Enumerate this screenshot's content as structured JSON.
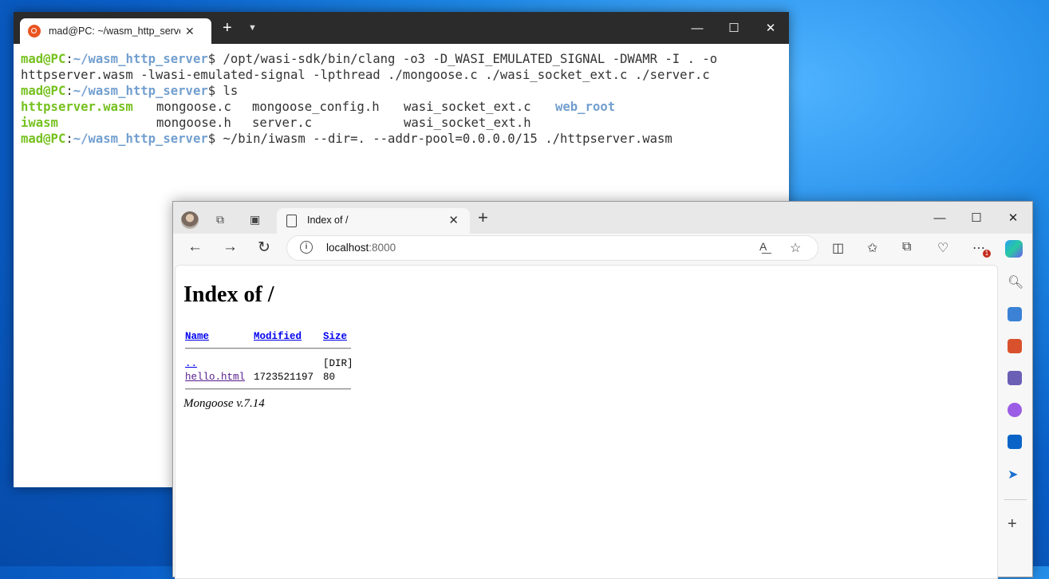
{
  "terminal": {
    "tab_title": "mad@PC: ~/wasm_http_server",
    "user_host": "mad@PC",
    "path": "~/wasm_http_server",
    "lines": [
      {
        "type": "prompt",
        "command": " /opt/wasi-sdk/bin/clang -o3 -D_WASI_EMULATED_SIGNAL -DWAMR -I . -o"
      },
      {
        "type": "plain",
        "text": "httpserver.wasm -lwasi-emulated-signal -lpthread ./mongoose.c ./wasi_socket_ext.c ./server.c"
      },
      {
        "type": "prompt",
        "command": " ls"
      },
      {
        "type": "plain",
        "text": ""
      },
      {
        "type": "plain",
        "text": ""
      },
      {
        "type": "prompt",
        "command": " ~/bin/iwasm --dir=. --addr-pool=0.0.0.0/15 ./httpserver.wasm"
      }
    ],
    "ls_row1": {
      "a": "httpserver.wasm",
      "b": "mongoose.c",
      "c": "mongoose_config.h",
      "d": "wasi_socket_ext.c",
      "e": "web_root"
    },
    "ls_row2": {
      "a": "iwasm",
      "b": "mongoose.h",
      "c": "server.c",
      "d": "wasi_socket_ext.h"
    },
    "colors": {
      "green": "#76c120",
      "blue": "#729fcf"
    }
  },
  "browser": {
    "tab_title": "Index of /",
    "url_host": "localhost",
    "url_port": ":8000",
    "notification_count": "1",
    "page": {
      "heading": "Index of /",
      "columns": [
        "Name",
        "Modified",
        "Size"
      ],
      "rows": [
        {
          "name": "..",
          "modified": "",
          "size": "[DIR]"
        },
        {
          "name": "hello.html",
          "modified": "1723521197",
          "size": "80"
        }
      ],
      "footer": "Mongoose v.7.14"
    }
  }
}
